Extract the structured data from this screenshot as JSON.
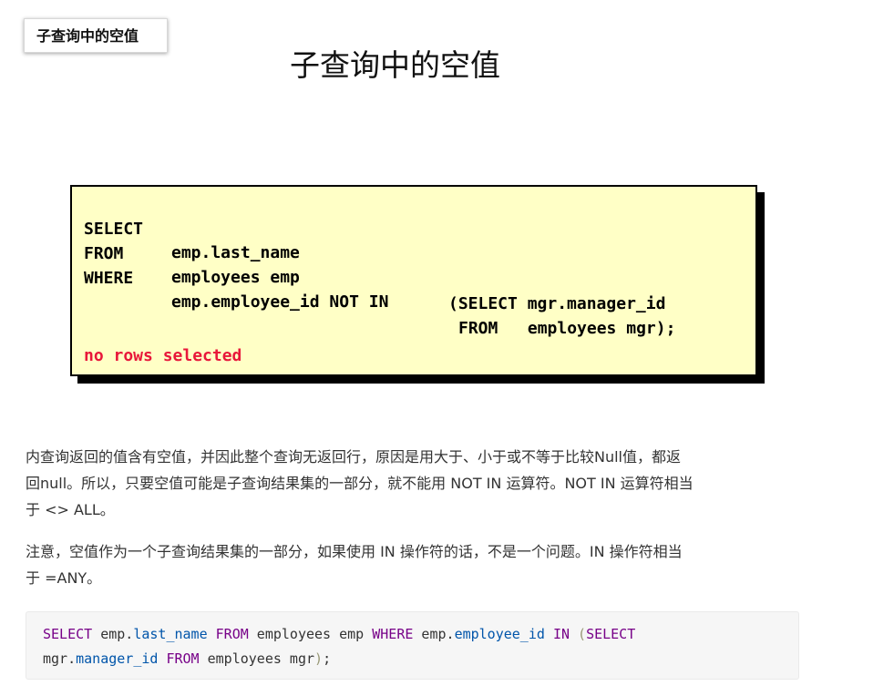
{
  "tag": {
    "label": "子查询中的空值"
  },
  "slide": {
    "title": "子查询中的空值"
  },
  "code_box": {
    "lines": [
      {
        "keyword": "SELECT",
        "rest": "emp.last_name"
      },
      {
        "keyword": "FROM",
        "rest": "employees emp"
      },
      {
        "keyword": "WHERE",
        "rest": "emp.employee_id NOT IN"
      },
      {
        "keyword": "",
        "rest": "(SELECT mgr.manager_id"
      },
      {
        "keyword": "",
        "rest": "FROM   employees mgr);"
      }
    ],
    "result": "no rows selected",
    "colors": {
      "background": "#ffffc6",
      "result": "#e8173a"
    }
  },
  "paragraphs": [
    {
      "lines": [
        "内查询返回的值含有空值，并因此整个查询无返回行，原因是用大于、小于或不等于比较Null值，都返",
        "回null。所以，只要空值可能是子查询结果集的一部分，就不能用 NOT IN 运算符。NOT IN 运算符相当",
        "于 <> ALL。"
      ]
    },
    {
      "lines": [
        "注意，空值作为一个子查询结果集的一部分，如果使用 IN 操作符的话，不是一个问题。IN 操作符相当",
        "于 =ANY。"
      ]
    }
  ],
  "sql_block": {
    "line1": {
      "t1": "SELECT",
      "t2": " emp.",
      "t3": "last_name",
      "t4": " ",
      "t5": "FROM",
      "t6": " employees emp ",
      "t7": "WHERE",
      "t8": " emp.",
      "t9": "employee_id",
      "t10": " ",
      "t11": "IN",
      "t12": " ",
      "t13": "(",
      "t14": "SELECT"
    },
    "line2": {
      "t1": "mgr.",
      "t2": "manager_id",
      "t3": " ",
      "t4": "FROM",
      "t5": " employees mgr",
      "t6": ")",
      "t7": ";"
    },
    "colors": {
      "keyword": "#770088",
      "property": "#0055aa",
      "bracket": "#999977"
    }
  }
}
